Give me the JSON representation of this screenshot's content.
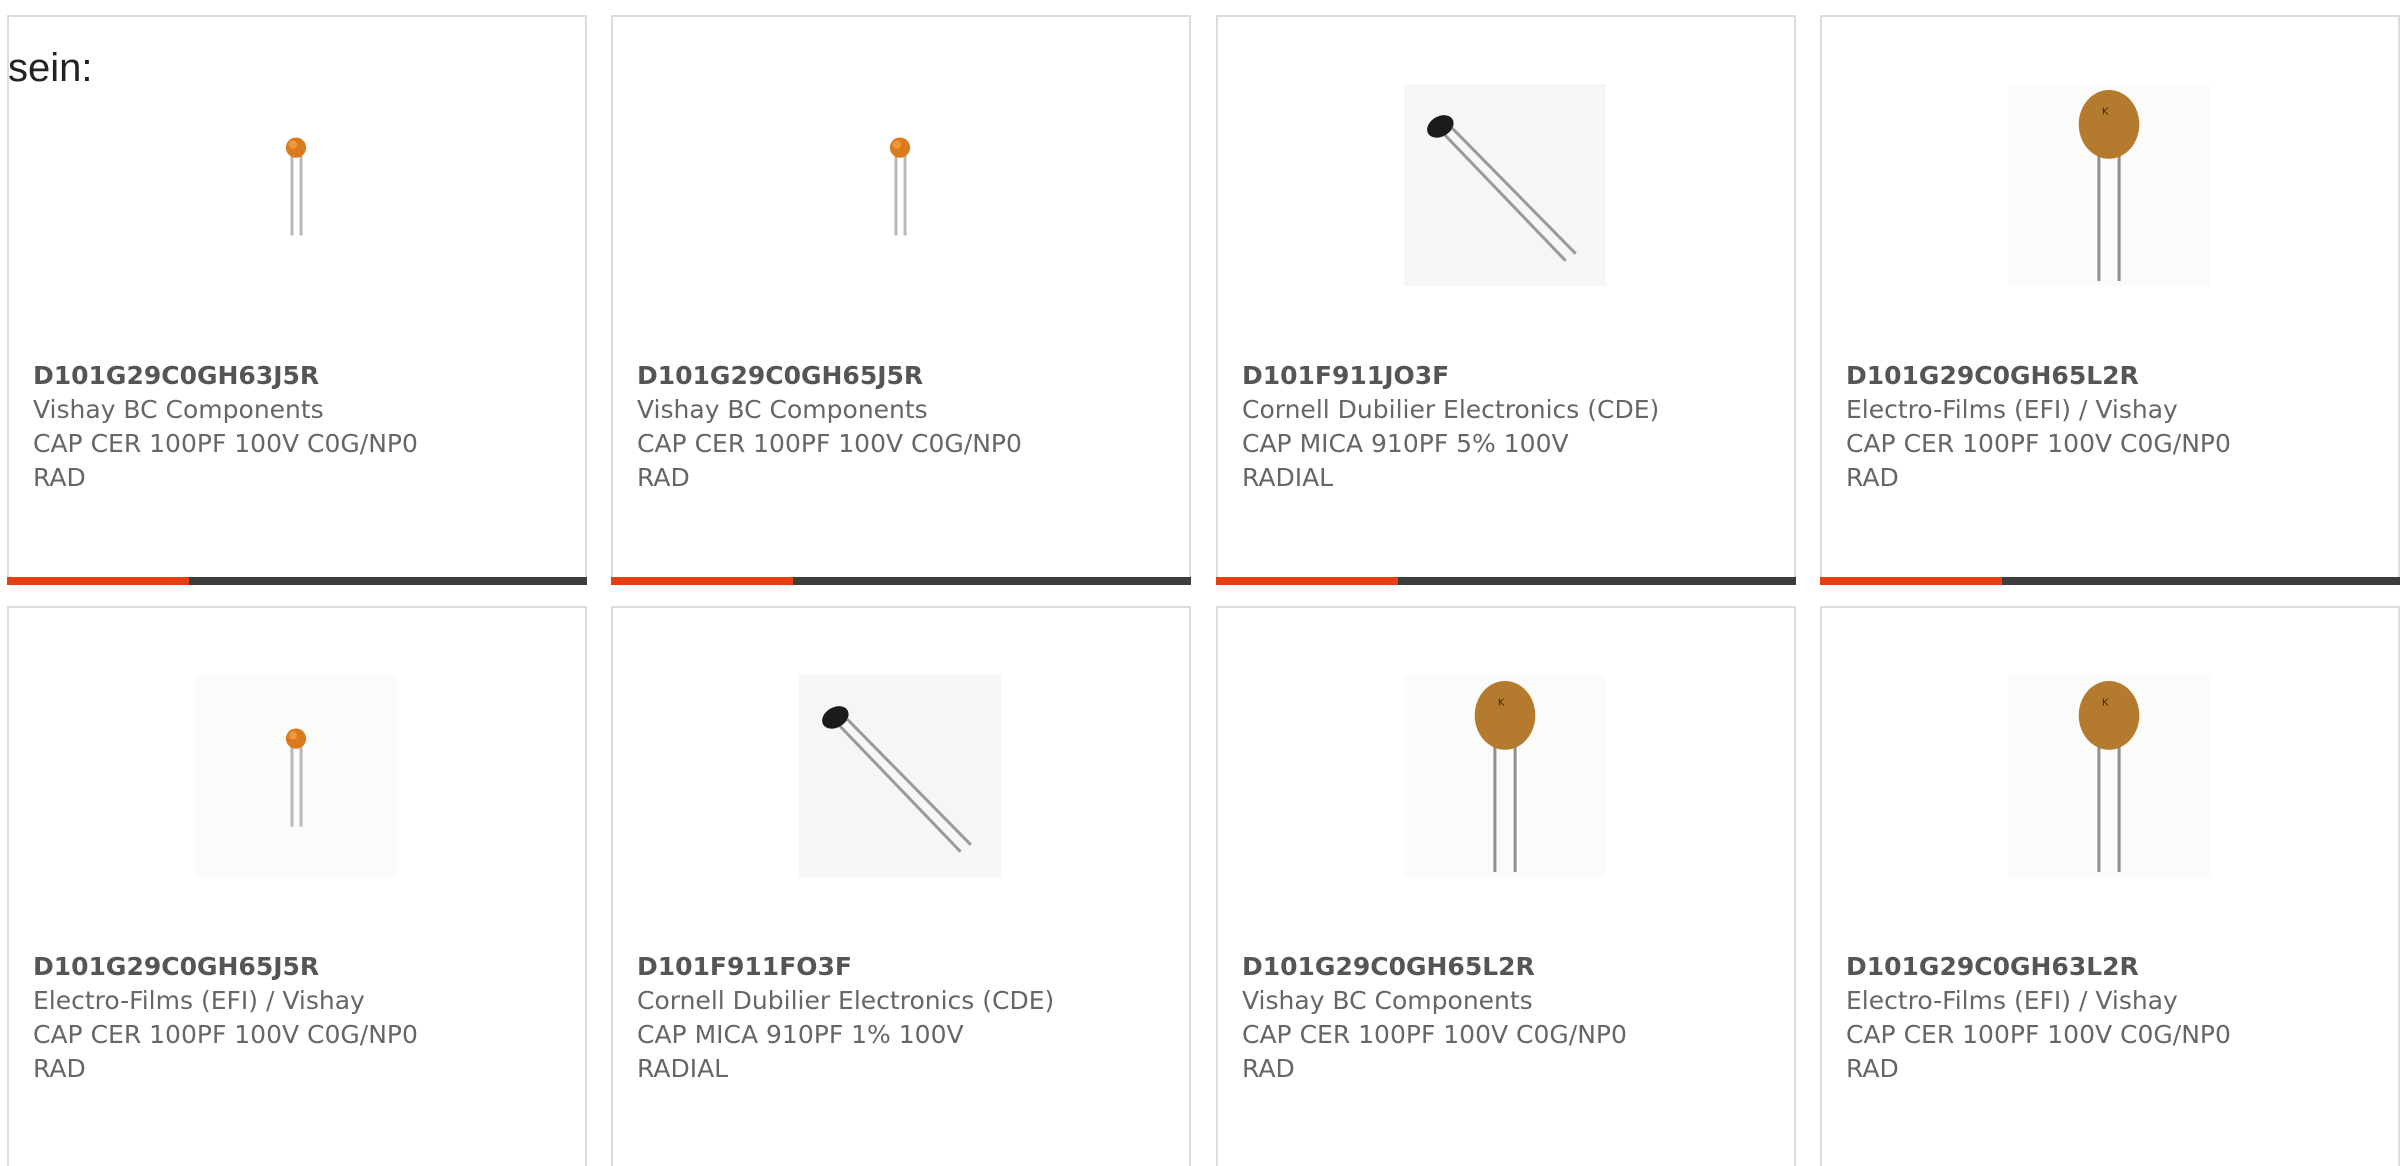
{
  "intro_text": "sein:",
  "colors": {
    "accent": "#e63f12",
    "bar_track": "#3d3d3d",
    "card_border": "#dcdcdc"
  },
  "products": [
    {
      "part": "D101G29C0GH63J5R",
      "maker": "Vishay BC Components",
      "desc": "CAP CER 100PF 100V C0G/NP0",
      "pkg": "RAD",
      "image_icon": "small-ceramic-capacitor-icon"
    },
    {
      "part": "D101G29C0GH65J5R",
      "maker": "Vishay BC Components",
      "desc": "CAP CER 100PF 100V C0G/NP0",
      "pkg": "RAD",
      "image_icon": "small-ceramic-capacitor-icon"
    },
    {
      "part": "D101F911JO3F",
      "maker": "Cornell Dubilier Electronics (CDE)",
      "desc": "CAP MICA 910PF 5% 100V",
      "pkg": "RADIAL",
      "image_icon": "mica-capacitor-icon"
    },
    {
      "part": "D101G29C0GH65L2R",
      "maker": "Electro-Films (EFI) / Vishay",
      "desc": "CAP CER 100PF 100V C0G/NP0",
      "pkg": "RAD",
      "image_icon": "disc-capacitor-icon"
    },
    {
      "part": "D101G29C0GH65J5R",
      "maker": "Electro-Films (EFI) / Vishay",
      "desc": "CAP CER 100PF 100V C0G/NP0",
      "pkg": "RAD",
      "image_icon": "small-ceramic-capacitor-icon"
    },
    {
      "part": "D101F911FO3F",
      "maker": "Cornell Dubilier Electronics (CDE)",
      "desc": "CAP MICA 910PF 1% 100V",
      "pkg": "RADIAL",
      "image_icon": "mica-capacitor-icon"
    },
    {
      "part": "D101G29C0GH65L2R",
      "maker": "Vishay BC Components",
      "desc": "CAP CER 100PF 100V C0G/NP0",
      "pkg": "RAD",
      "image_icon": "disc-capacitor-icon"
    },
    {
      "part": "D101G29C0GH63L2R",
      "maker": "Electro-Films (EFI) / Vishay",
      "desc": "CAP CER 100PF 100V C0G/NP0",
      "pkg": "RAD",
      "image_icon": "disc-capacitor-icon"
    }
  ]
}
